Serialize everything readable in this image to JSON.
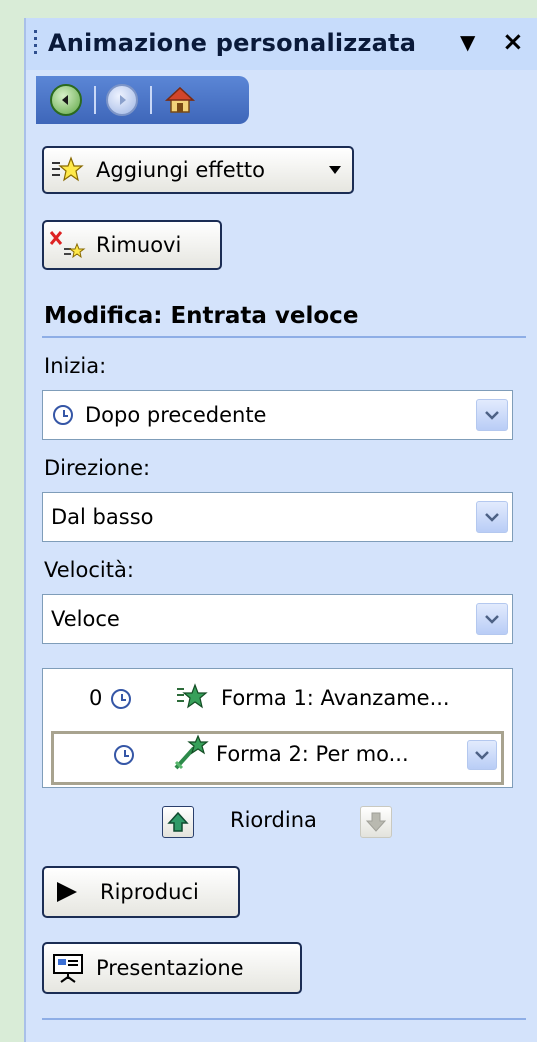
{
  "title": "Animazione personalizzata",
  "title_dropdown_glyph": "▼",
  "close_glyph": "×",
  "nav": {
    "back_icon": "back-arrow-icon",
    "forward_icon": "forward-arrow-icon",
    "home_icon": "home-icon"
  },
  "buttons": {
    "add_effect": "Aggiungi effetto",
    "remove": "Rimuovi",
    "play": "Riproduci",
    "slideshow": "Presentazione"
  },
  "section_title": "Modifica: Entrata veloce",
  "start": {
    "label": "Inizia:",
    "value": "Dopo precedente"
  },
  "direction": {
    "label": "Direzione:",
    "value": "Dal basso"
  },
  "speed": {
    "label": "Velocità:",
    "value": "Veloce"
  },
  "effects": [
    {
      "number": "0",
      "text": "Forma 1: Avanzame...",
      "selected": false
    },
    {
      "number": "",
      "text": "Forma 2: Per mo...",
      "selected": true
    }
  ],
  "reorder": {
    "label": "Riordina"
  },
  "colors": {
    "pane_bg": "#d4e3fb",
    "title_bg": "#c7dcfb",
    "accent": "#3e66b9",
    "outer_bg": "#d9ecd7"
  }
}
